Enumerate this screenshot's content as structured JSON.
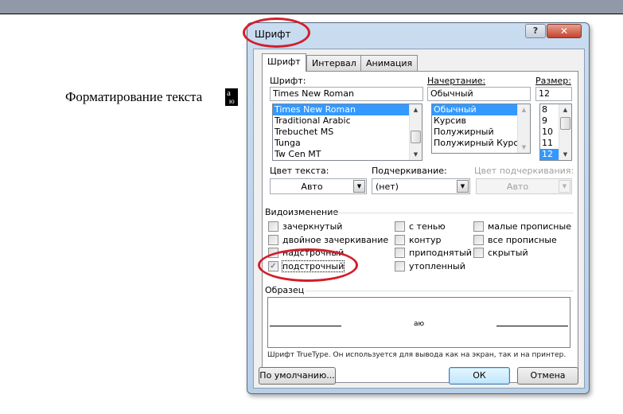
{
  "document": {
    "text": "Форматирование текста",
    "selected_glyph_top": "а",
    "selected_glyph_bottom": "ю"
  },
  "dialog": {
    "title": "Шрифт",
    "help_icon": "?",
    "close_icon": "✕",
    "tabs": [
      {
        "label": "Шрифт",
        "active": true
      },
      {
        "label": "Интервал",
        "active": false
      },
      {
        "label": "Анимация",
        "active": false
      }
    ],
    "font": {
      "label": "Шрифт:",
      "value": "Times New Roman",
      "items": [
        "Times New Roman",
        "Traditional Arabic",
        "Trebuchet MS",
        "Tunga",
        "Tw Cen MT"
      ],
      "selected_index": 0
    },
    "style": {
      "label": "Начертание:",
      "value": "Обычный",
      "items": [
        "Обычный",
        "Курсив",
        "Полужирный",
        "Полужирный Курсив"
      ],
      "selected_index": 0
    },
    "size": {
      "label": "Размер:",
      "value": "12",
      "items": [
        "8",
        "9",
        "10",
        "11",
        "12"
      ],
      "selected_index": 4
    },
    "text_color": {
      "label": "Цвет текста:",
      "value": "Авто"
    },
    "underline": {
      "label": "Подчеркивание:",
      "value": "(нет)"
    },
    "underline_color": {
      "label": "Цвет подчеркивания:",
      "value": "Авто",
      "disabled": true
    },
    "effects": {
      "label": "Видоизменение",
      "col1": [
        {
          "label": "зачеркнутый",
          "checked": false
        },
        {
          "label": "двойное зачеркивание",
          "checked": false
        },
        {
          "label": "надстрочный",
          "checked": false
        },
        {
          "label": "подстрочный",
          "checked": true
        }
      ],
      "col2": [
        {
          "label": "с тенью",
          "checked": false
        },
        {
          "label": "контур",
          "checked": false
        },
        {
          "label": "приподнятый",
          "checked": false
        },
        {
          "label": "утопленный",
          "checked": false
        }
      ],
      "col3": [
        {
          "label": "малые прописные",
          "checked": false
        },
        {
          "label": "все прописные",
          "checked": false
        },
        {
          "label": "скрытый",
          "checked": false
        }
      ]
    },
    "preview": {
      "label": "Образец",
      "sample": "аю",
      "note": "Шрифт TrueType. Он используется для вывода как на экран, так и на принтер."
    },
    "buttons": {
      "default": "По умолчанию...",
      "ok": "ОК",
      "cancel": "Отмена"
    },
    "check_mark": "✓",
    "scroll_up": "▲",
    "scroll_down": "▼",
    "combo_arrow": "▼"
  },
  "annotation_color": "#d21e2b"
}
